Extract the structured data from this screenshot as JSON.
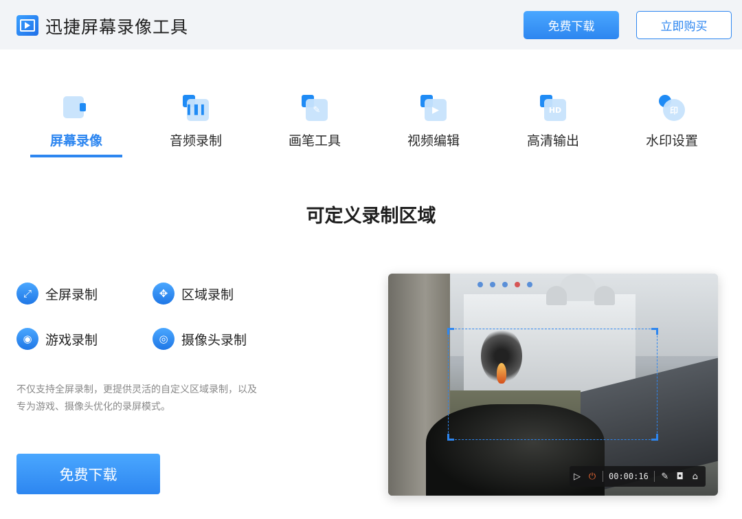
{
  "header": {
    "title": "迅捷屏幕录像工具",
    "download_label": "免费下载",
    "buy_label": "立即购买"
  },
  "tabs": [
    {
      "label": "屏幕录像",
      "icon": "screen-record-icon",
      "active": true
    },
    {
      "label": "音频录制",
      "icon": "audio-record-icon",
      "active": false
    },
    {
      "label": "画笔工具",
      "icon": "brush-tool-icon",
      "active": false
    },
    {
      "label": "视频编辑",
      "icon": "video-edit-icon",
      "active": false
    },
    {
      "label": "高清输出",
      "icon": "hd-output-icon",
      "active": false
    },
    {
      "label": "水印设置",
      "icon": "watermark-icon",
      "active": false
    }
  ],
  "tab_glyphs": {
    "hd": "HD",
    "watermark": "印"
  },
  "section": {
    "title": "可定义录制区域"
  },
  "features": [
    {
      "label": "全屏录制",
      "icon": "fullscreen-icon"
    },
    {
      "label": "区域录制",
      "icon": "region-move-icon"
    },
    {
      "label": "游戏录制",
      "icon": "gamepad-icon"
    },
    {
      "label": "摄像头录制",
      "icon": "webcam-icon"
    }
  ],
  "description": "不仅支持全屏录制，更提供灵活的自定义区域录制，以及专为游戏、摄像头优化的录屏模式。",
  "main_download_label": "免费下载",
  "preview": {
    "timer": "00:00:16",
    "toolbar_icons": [
      "play-icon",
      "power-icon",
      "pen-icon",
      "camera-icon",
      "home-icon"
    ]
  },
  "colors": {
    "accent": "#2d86f0",
    "header_bg": "#f2f4f7",
    "stop": "#f26b35"
  }
}
